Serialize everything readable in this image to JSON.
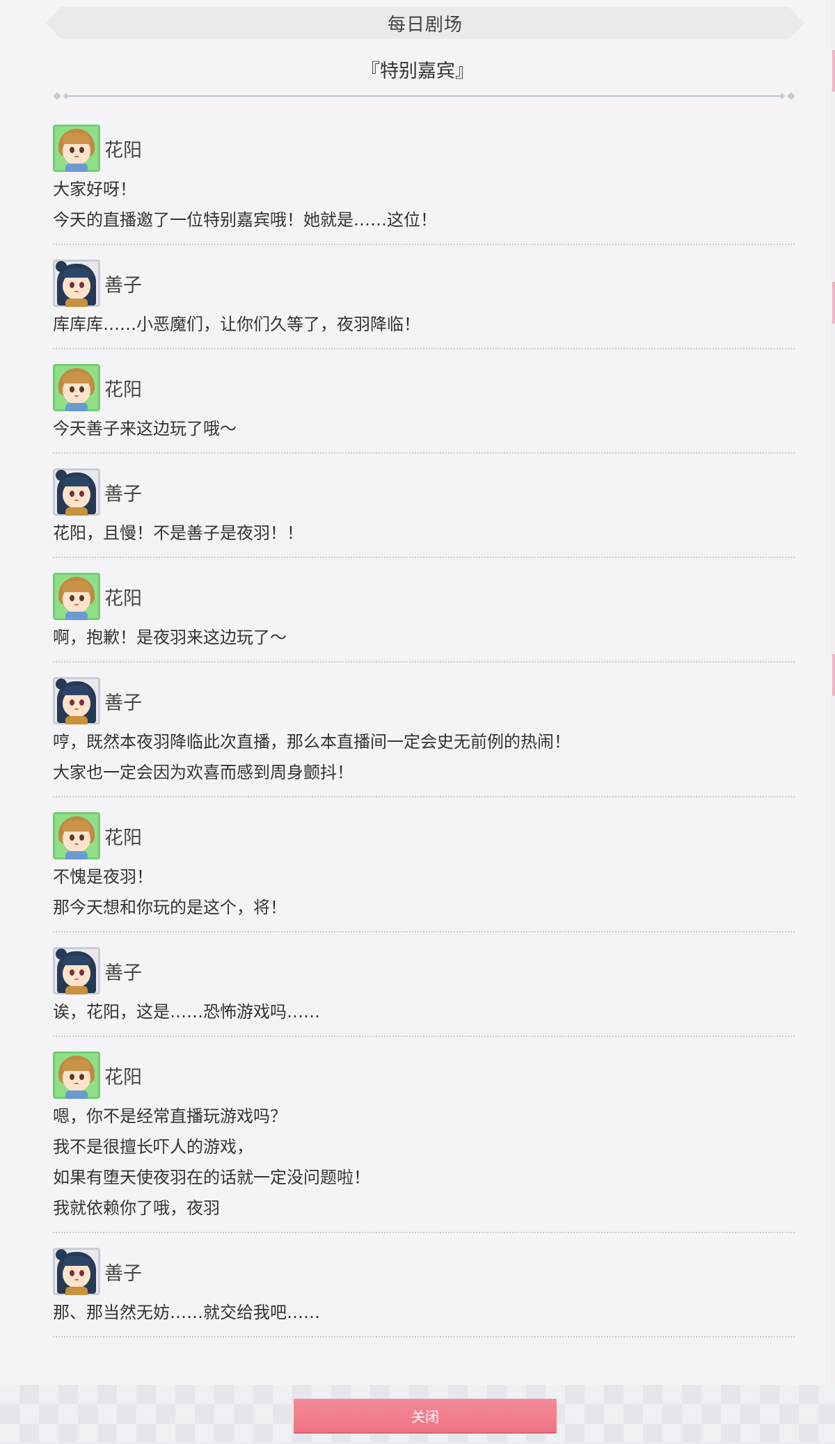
{
  "header": {
    "title": "每日剧场"
  },
  "episode": {
    "title": "『特别嘉宾』"
  },
  "dialogue": [
    {
      "speaker": "花阳",
      "lines": [
        "大家好呀！",
        "今天的直播邀了一位特别嘉宾哦！她就是……这位！"
      ]
    },
    {
      "speaker": "善子",
      "lines": [
        "库库库……小恶魔们，让你们久等了，夜羽降临！"
      ]
    },
    {
      "speaker": "花阳",
      "lines": [
        "今天善子来这边玩了哦～"
      ]
    },
    {
      "speaker": "善子",
      "lines": [
        "花阳，且慢！不是善子是夜羽！！"
      ]
    },
    {
      "speaker": "花阳",
      "lines": [
        "啊，抱歉！是夜羽来这边玩了～"
      ]
    },
    {
      "speaker": "善子",
      "lines": [
        "哼，既然本夜羽降临此次直播，那么本直播间一定会史无前例的热闹！",
        "大家也一定会因为欢喜而感到周身颤抖！"
      ]
    },
    {
      "speaker": "花阳",
      "lines": [
        "不愧是夜羽！",
        "那今天想和你玩的是这个，将！"
      ]
    },
    {
      "speaker": "善子",
      "lines": [
        "诶，花阳，这是……恐怖游戏吗……"
      ]
    },
    {
      "speaker": "花阳",
      "lines": [
        "嗯，你不是经常直播玩游戏吗？",
        "我不是很擅长吓人的游戏，",
        "如果有堕天使夜羽在的话就一定没问题啦！",
        "我就依赖你了哦，夜羽"
      ]
    },
    {
      "speaker": "善子",
      "lines": [
        "那、那当然无妨……就交给我吧……"
      ]
    }
  ],
  "footer": {
    "close_label": "关闭"
  },
  "colors": {
    "accent": "#f07a8a",
    "hanayo_frame": "#8fdf87",
    "yoshiko_frame": "#e7e9ee"
  }
}
